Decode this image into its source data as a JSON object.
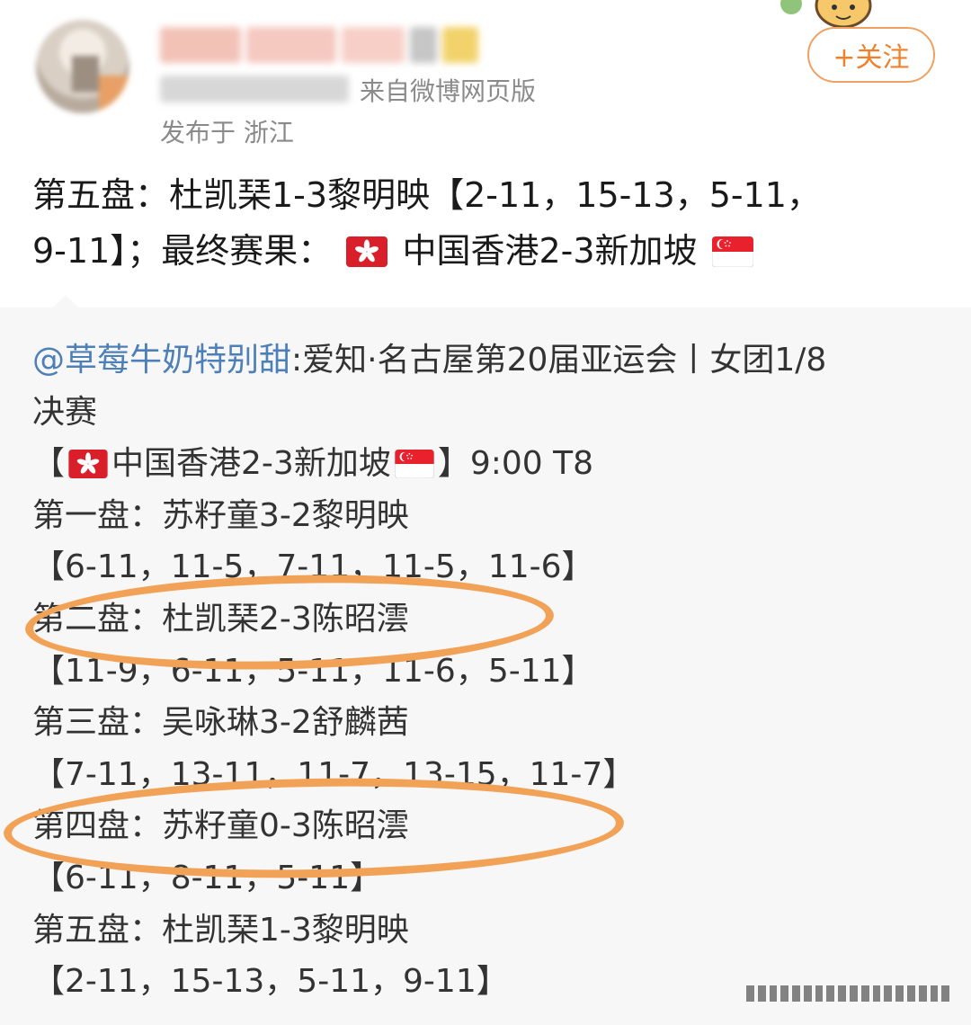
{
  "header": {
    "source_text": "来自微博网页版",
    "location_text": "发布于 浙江",
    "follow_label": "+关注",
    "name_blur_colors": [
      "#f2c2b7",
      "#f5c8c0",
      "#f7cfc7",
      "#c6c6c6",
      "#f2d26a"
    ],
    "accent_color": "#f0812a"
  },
  "post": {
    "line1": "第五盘：杜凯琹1-3黎明映【2-11，15-13，5-11，",
    "line2_start": "9-11】；最终赛果：",
    "line2_team1": "中国香港2-3新加坡"
  },
  "repost": {
    "mention": "@草莓牛奶特别甜",
    "title_rest": ":爱知·名古屋第20届亚运会丨女团1/8",
    "title_cont": "决赛",
    "match_open": "【",
    "match_teams": "中国香港2-3新加坡",
    "match_close": "】9:00 T8",
    "games": [
      {
        "label": "第一盘：苏籽童3-2黎明映",
        "scores": "【6-11，11-5，7-11，11-5，11-6】"
      },
      {
        "label": "第二盘：杜凯琹2-3陈昭澐",
        "scores": "【11-9，6-11，5-11，11-6，5-11】"
      },
      {
        "label": "第三盘：吴咏琳3-2舒麟茜",
        "scores": "【7-11，13-11，11-7，13-15，11-7】"
      },
      {
        "label": "第四盘：苏籽童0-3陈昭澐",
        "scores": "【6-11，8-11，5-11】"
      },
      {
        "label": "第五盘：杜凯琹1-3黎明映",
        "scores": "【2-11，15-13，5-11，9-11】"
      }
    ],
    "highlight_color": "#f1a257",
    "mention_color": "#4d7fb8"
  },
  "icons": {
    "hk_flag": "hong-kong-flag-icon",
    "sg_flag": "singapore-flag-icon"
  }
}
